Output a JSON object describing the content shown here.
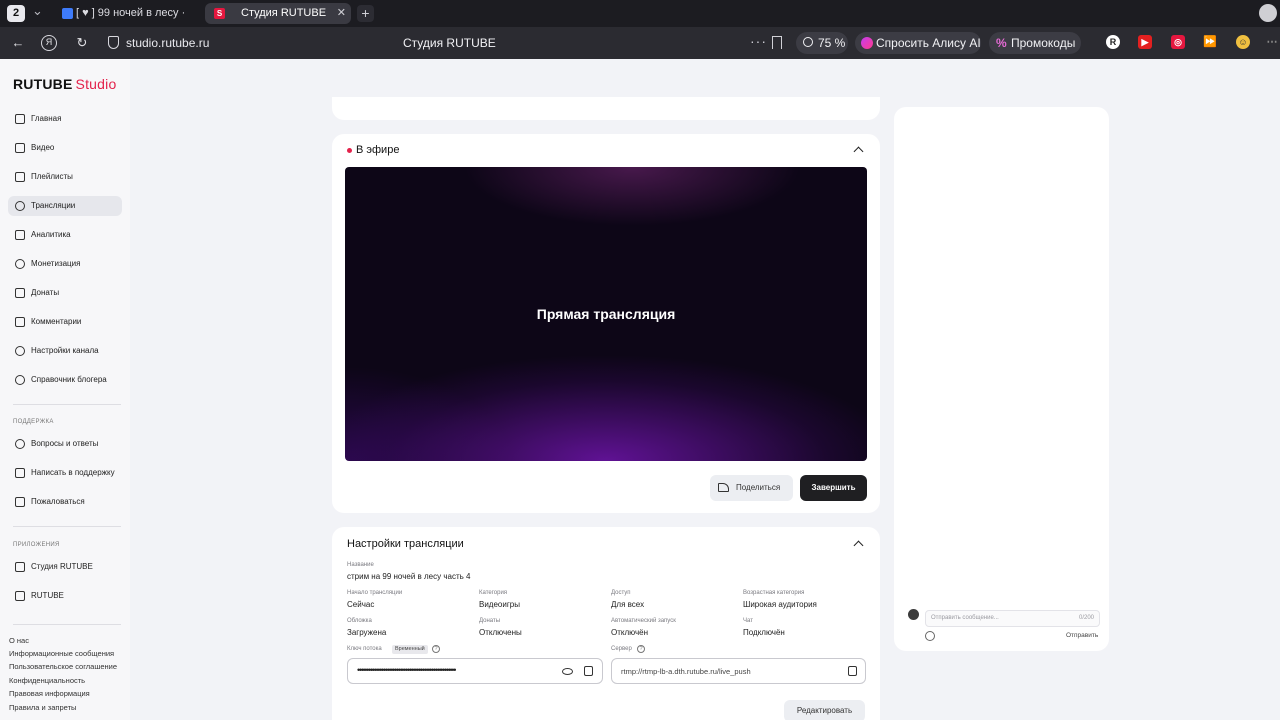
{
  "browser": {
    "tab_count": "2",
    "tabs": [
      {
        "label": "[ ♥ ] 99 ночей в лесу ·"
      },
      {
        "label": "Студия RUTUBE",
        "favicon": "S"
      }
    ],
    "url": "studio.rutube.ru",
    "page_title": "Студия RUTUBE",
    "zoom": "75 %",
    "alice_label": "Спросить Алису AI",
    "promo_label": "Промокоды"
  },
  "sidebar": {
    "logo_main": "RUTUBE",
    "logo_accent": "Studio",
    "items": [
      {
        "label": "Главная"
      },
      {
        "label": "Видео"
      },
      {
        "label": "Плейлисты"
      },
      {
        "label": "Трансляции"
      },
      {
        "label": "Аналитика"
      },
      {
        "label": "Монетизация"
      },
      {
        "label": "Донаты"
      },
      {
        "label": "Комментарии"
      },
      {
        "label": "Настройки канала"
      },
      {
        "label": "Справочник блогера"
      }
    ],
    "support_label": "ПОДДЕРЖКА",
    "support_items": [
      {
        "label": "Вопросы и ответы"
      },
      {
        "label": "Написать в поддержку"
      },
      {
        "label": "Пожаловаться"
      }
    ],
    "apps_label": "ПРИЛОЖЕНИЯ",
    "app_items": [
      {
        "label": "Студия RUTUBE"
      },
      {
        "label": "RUTUBE"
      }
    ],
    "footer": [
      "О нас",
      "Информационные сообщения",
      "Пользовательское соглашение",
      "Конфиденциальность",
      "Правовая информация",
      "Правила и запреты"
    ]
  },
  "live": {
    "header": "В эфире",
    "video_title": "Прямая трансляция",
    "share_label": "Поделиться",
    "end_label": "Завершить"
  },
  "settings": {
    "title": "Настройки трансляции",
    "name_label": "Название",
    "name_value": "стрим на 99 ночей в лесу часть 4",
    "fields": [
      {
        "label": "Начало трансляции",
        "value": "Сейчас"
      },
      {
        "label": "Категория",
        "value": "Видеоигры"
      },
      {
        "label": "Доступ",
        "value": "Для всех"
      },
      {
        "label": "Возрастная категория",
        "value": "Широкая аудитория"
      },
      {
        "label": "Обложка",
        "value": "Загружена"
      },
      {
        "label": "Донаты",
        "value": "Отключены"
      },
      {
        "label": "Автоматический запуск",
        "value": "Отключён"
      },
      {
        "label": "Чат",
        "value": "Подключён"
      }
    ],
    "key_label": "Ключ потока",
    "key_badge": "Временный",
    "key_value": "•••••••••••••••••••••••••••••••••••••••••••••••••••••",
    "server_label": "Сервер",
    "server_value": "rtmp://rtmp-lb-a.dth.rutube.ru/live_push",
    "edit_label": "Редактировать"
  },
  "chat": {
    "placeholder": "Отправить сообщение...",
    "counter": "0/200",
    "send_label": "Отправить"
  },
  "colors": {
    "accent": "#e3224b",
    "dark_button": "#1f1f22"
  }
}
